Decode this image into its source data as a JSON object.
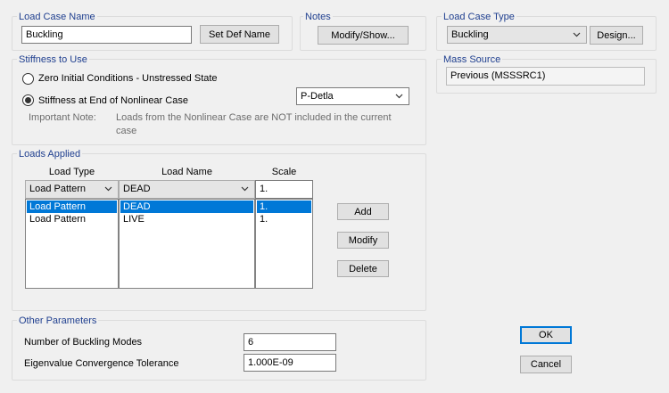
{
  "load_case_name": {
    "title": "Load Case Name",
    "value": "Buckling",
    "set_def_name_button": "Set Def Name"
  },
  "notes": {
    "title": "Notes",
    "modify_show_button": "Modify/Show..."
  },
  "load_case_type": {
    "title": "Load Case Type",
    "selected": "Buckling",
    "design_button": "Design..."
  },
  "mass_source": {
    "title": "Mass Source",
    "value": "Previous  (MSSSRC1)"
  },
  "stiffness": {
    "title": "Stiffness to Use",
    "option_zero": "Zero Initial Conditions - Unstressed State",
    "option_end": "Stiffness at End of Nonlinear Case",
    "selected_option": "end",
    "nonlinear_case": "P-Detla",
    "note_label": "Important Note:",
    "note_text_1": "Loads from the Nonlinear Case are NOT included in the current",
    "note_text_2": "case"
  },
  "loads_applied": {
    "title": "Loads Applied",
    "columns": {
      "load_type": "Load Type",
      "load_name": "Load Name",
      "scale": "Scale"
    },
    "edit_row": {
      "load_type": "Load Pattern",
      "load_name": "DEAD",
      "scale": "1."
    },
    "rows": [
      {
        "load_type": "Load Pattern",
        "load_name": "DEAD",
        "scale": "1.",
        "selected": true
      },
      {
        "load_type": "Load Pattern",
        "load_name": "LIVE",
        "scale": "1.",
        "selected": false
      }
    ],
    "add_button": "Add",
    "modify_button": "Modify",
    "delete_button": "Delete"
  },
  "other_parameters": {
    "title": "Other Parameters",
    "num_modes_label": "Number of Buckling Modes",
    "num_modes_value": "6",
    "tolerance_label": "Eigenvalue Convergence Tolerance",
    "tolerance_value": "1.000E-09"
  },
  "dialog": {
    "ok_button": "OK",
    "cancel_button": "Cancel"
  },
  "colors": {
    "group_title": "#1f3f8f",
    "selection": "#0078d7"
  }
}
